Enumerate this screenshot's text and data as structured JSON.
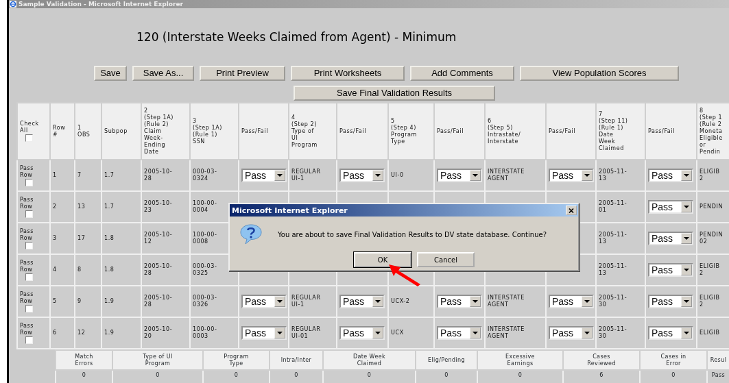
{
  "window": {
    "title": "Sample Validation - Microsoft Internet Explorer"
  },
  "page_title": "120 (Interstate Weeks Claimed from Agent) - Minimum",
  "toolbar_buttons": [
    "Save",
    "Save As...",
    "Print Preview",
    "Print Worksheets",
    "Add Comments",
    "View Population Scores"
  ],
  "primary_button": "Save Final Validation Results",
  "table": {
    "columns": [
      {
        "kind": "check_all",
        "label": "Check\nAll",
        "checked": false
      },
      {
        "kind": "text",
        "label": "Row\n#"
      },
      {
        "kind": "text",
        "label": "1\nOBS"
      },
      {
        "kind": "text",
        "label": "Subpop"
      },
      {
        "kind": "text",
        "label": "2\n(Step 1A)\n(Rule 2)\nClaim\nWeek-\nEnding\nDate"
      },
      {
        "kind": "text",
        "label": "3\n(Step 1A)\n(Rule 1)\nSSN"
      },
      {
        "kind": "text",
        "label": "Pass/Fail"
      },
      {
        "kind": "text",
        "label": "4\n(Step 2)\nType of\nUI\nProgram"
      },
      {
        "kind": "text",
        "label": "Pass/Fail"
      },
      {
        "kind": "text",
        "label": "5\n(Step 4)\nProgram\nType"
      },
      {
        "kind": "text",
        "label": "Pass/Fail"
      },
      {
        "kind": "text",
        "label": "6\n(Step 5)\nIntrastate/\nInterstate"
      },
      {
        "kind": "text",
        "label": "Pass/Fail"
      },
      {
        "kind": "text",
        "label": "7\n(Step 11)\n(Rule 1)\nDate\nWeek\nClaimed"
      },
      {
        "kind": "text",
        "label": "Pass/Fail"
      },
      {
        "kind": "text",
        "label": "8\n(Step 1\n(Rule 2\nMoneta\nEligible\nor\nPendin"
      }
    ],
    "rows": [
      {
        "cells": [
          {
            "label": "Pass\nRow",
            "checked": false
          },
          "1",
          "7",
          "1.7",
          "2005-10-\n28",
          "000-03-\n0324",
          {
            "value": "Pass"
          },
          "REGULAR\nUI-1",
          {
            "value": "Pass"
          },
          "UI-0",
          {
            "value": "Pass"
          },
          "INTERSTATE\nAGENT",
          {
            "value": "Pass"
          },
          "2005-11-\n13",
          {
            "value": "Pass"
          },
          "ELIGIB\n2"
        ]
      },
      {
        "cells": [
          {
            "label": "Pass\nRow",
            "checked": false
          },
          "2",
          "13",
          "1.7",
          "2005-10-\n23",
          "100-00-\n0004",
          null,
          null,
          null,
          null,
          null,
          null,
          null,
          "2005-11-\n01",
          {
            "value": "Pass"
          },
          "PENDIN"
        ]
      },
      {
        "cells": [
          {
            "label": "Pass\nRow",
            "checked": false
          },
          "3",
          "17",
          "1.8",
          "2005-10-\n12",
          "100-00-\n0008",
          null,
          null,
          null,
          null,
          null,
          null,
          null,
          "2005-11-\n13",
          {
            "value": "Pass"
          },
          "PENDIN\n02"
        ]
      },
      {
        "cells": [
          {
            "label": "Pass\nRow",
            "checked": false
          },
          "4",
          "8",
          "1.8",
          "2005-10-\n28",
          "000-03-\n0325",
          null,
          null,
          null,
          null,
          null,
          null,
          null,
          "2005-11-\n13",
          {
            "value": "Pass"
          },
          "ELIGIB\n2"
        ]
      },
      {
        "cells": [
          {
            "label": "Pass\nRow",
            "checked": false
          },
          "5",
          "9",
          "1.9",
          "2005-10-\n28",
          "000-03-\n0326",
          {
            "value": "Pass"
          },
          "REGULAR\nUI-1",
          {
            "value": "Pass"
          },
          "UCX-2",
          {
            "value": "Pass"
          },
          "INTERSTATE\nAGENT",
          {
            "value": "Pass"
          },
          "2005-11-\n30",
          {
            "value": "Pass"
          },
          "ELIGIB\n2"
        ]
      },
      {
        "cells": [
          {
            "label": "Pass\nRow",
            "checked": false
          },
          "6",
          "12",
          "1.9",
          "2005-10-\n20",
          "100-00-\n0003",
          {
            "value": "Pass"
          },
          "REGULAR\nUI-01",
          {
            "value": "Pass"
          },
          "UCX",
          {
            "value": "Pass"
          },
          "INTERSTATE\nAGENT",
          {
            "value": "Pass"
          },
          "2005-11-\n30",
          {
            "value": "Pass"
          },
          "ELIGIB"
        ]
      }
    ]
  },
  "summary": {
    "columns": [
      "Match\nErrors",
      "Type of UI\nProgram",
      "Program\nType",
      "Intra/Inter",
      "Date Week\nClaimed",
      "Elig/Pending",
      "Excessive\nEarnings",
      "Cases\nReviewed",
      "Cases in\nError",
      "Resul"
    ],
    "values": [
      "0",
      "0",
      "0",
      "0",
      "0",
      "0",
      "0",
      "6",
      "0",
      "Pass"
    ]
  },
  "dialog": {
    "title": "Microsoft Internet Explorer",
    "message": "You are about to save Final Validation Results to DV state database. Continue?",
    "buttons": [
      {
        "label": "OK",
        "focused": true
      },
      {
        "label": "Cancel",
        "focused": false
      }
    ]
  }
}
